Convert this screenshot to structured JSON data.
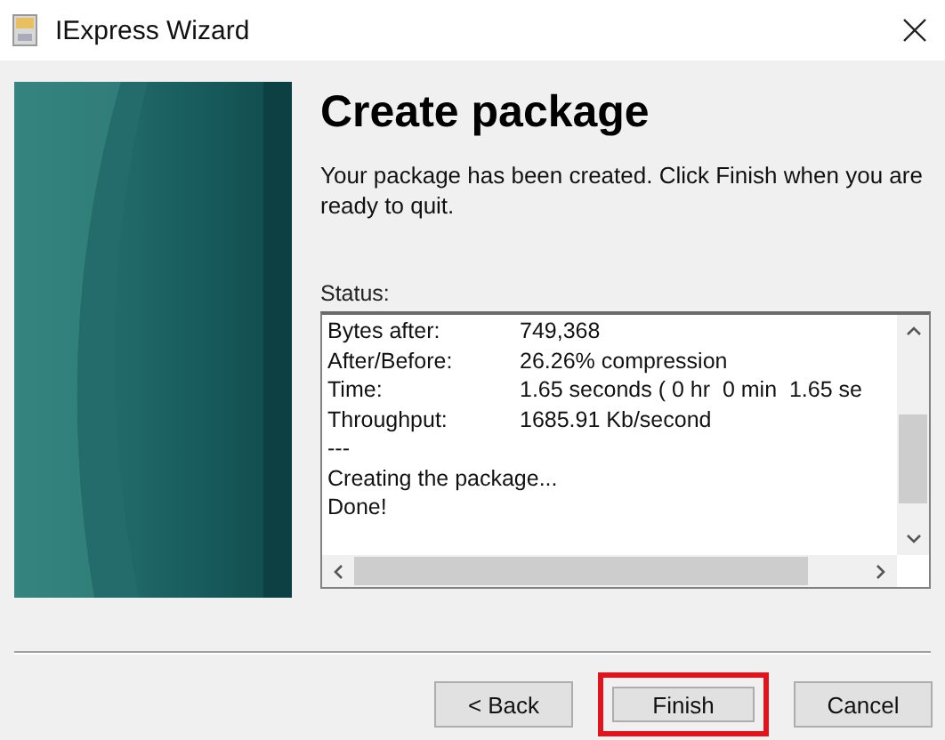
{
  "window": {
    "title": "IExpress Wizard"
  },
  "heading": "Create package",
  "description": "Your package has been created.  Click Finish when you are ready to quit.",
  "status": {
    "label": "Status:",
    "lines": [
      {
        "kind": "pair",
        "label": "Bytes after:",
        "value": "749,368"
      },
      {
        "kind": "pair",
        "label": "After/Before:",
        "value": "26.26% compression"
      },
      {
        "kind": "pair",
        "label": "Time:",
        "value": "1.65 seconds ( 0 hr  0 min  1.65 se"
      },
      {
        "kind": "pair",
        "label": "Throughput:",
        "value": "1685.91 Kb/second"
      },
      {
        "kind": "text",
        "text": "---"
      },
      {
        "kind": "text",
        "text": "Creating the package..."
      },
      {
        "kind": "text",
        "text": "Done!"
      }
    ]
  },
  "buttons": [
    {
      "label": "< Back",
      "highlighted": false
    },
    {
      "label": "Finish",
      "highlighted": true
    },
    {
      "label": "Cancel",
      "highlighted": false
    }
  ]
}
